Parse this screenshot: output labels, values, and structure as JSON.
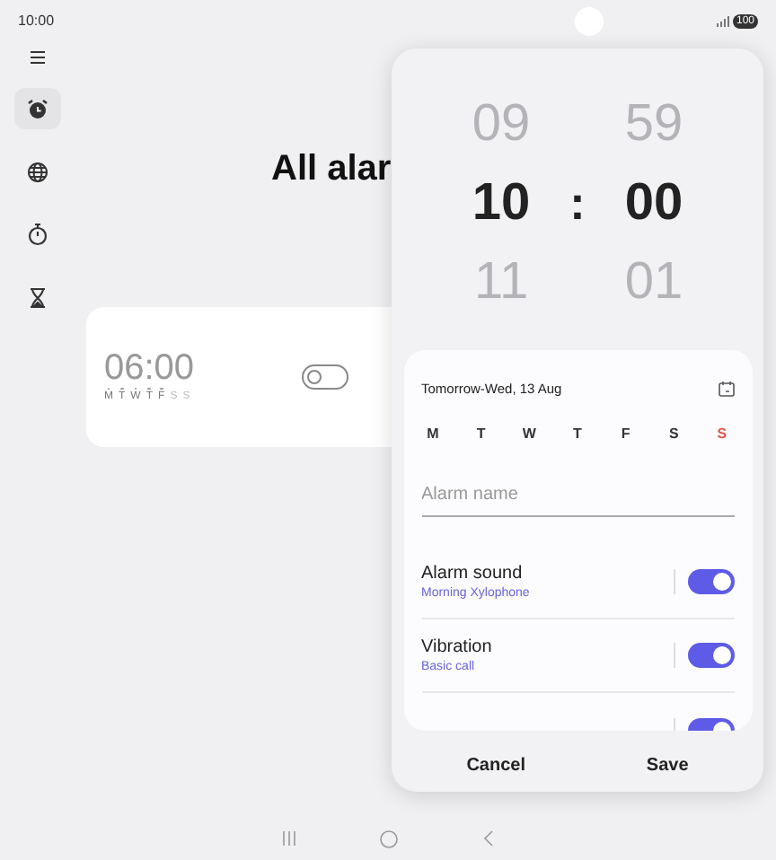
{
  "status_bar": {
    "time": "10:00",
    "battery": "100"
  },
  "sidebar": {
    "items": [
      {
        "kind": "alarm",
        "selected": true
      },
      {
        "kind": "world",
        "selected": false
      },
      {
        "kind": "stopwatch",
        "selected": false
      },
      {
        "kind": "timer",
        "selected": false
      }
    ]
  },
  "title": "All alar",
  "alarms": [
    {
      "time": "06:00",
      "on": false,
      "days": [
        {
          "label": "M",
          "active": true
        },
        {
          "label": "T",
          "active": true
        },
        {
          "label": "W",
          "active": true
        },
        {
          "label": "T",
          "active": true
        },
        {
          "label": "F",
          "active": true
        },
        {
          "label": "S",
          "active": false
        },
        {
          "label": "S",
          "active": false
        }
      ]
    }
  ],
  "sheet": {
    "picker": {
      "hours": [
        "09",
        "10",
        "11"
      ],
      "minutes": [
        "59",
        "00",
        "01"
      ],
      "separator": ":"
    },
    "date": "Tomorrow-Wed, 13 Aug",
    "weekdays": [
      {
        "label": "M",
        "color": "#333333"
      },
      {
        "label": "T",
        "color": "#333333"
      },
      {
        "label": "W",
        "color": "#333333"
      },
      {
        "label": "T",
        "color": "#333333"
      },
      {
        "label": "F",
        "color": "#333333"
      },
      {
        "label": "S",
        "color": "#333333"
      },
      {
        "label": "S",
        "color": "#e0554f"
      }
    ],
    "name_field": {
      "placeholder": "Alarm name"
    },
    "options": [
      {
        "title": "Alarm sound",
        "value": "Morning Xylophone",
        "on": true
      },
      {
        "title": "Vibration",
        "value": "Basic call",
        "on": true
      },
      {
        "on": true
      }
    ],
    "buttons": [
      "Cancel",
      "Save"
    ]
  }
}
